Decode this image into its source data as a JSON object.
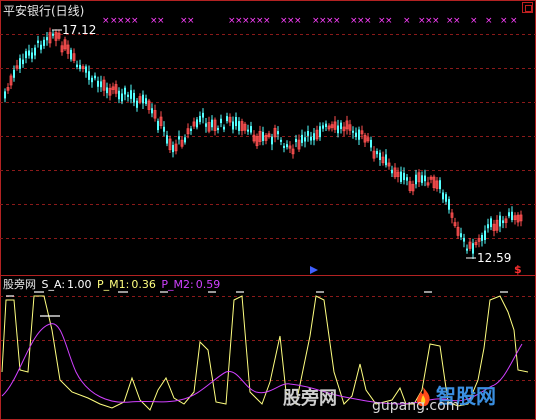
{
  "window": {
    "title": "平安银行(日线)"
  },
  "price_chart": {
    "high_label": "17.12",
    "low_label": "12.59",
    "cross_marker_glyph": "×",
    "colors": {
      "up": "#ff5050",
      "down": "#54ffff",
      "grid": "#8b1a1a",
      "frame": "#b22222",
      "cross": "#ff40ff"
    }
  },
  "indicator": {
    "name": "股旁网",
    "sa_label": "S_A:",
    "sa_value": "1.00",
    "pm1_label": "P_M1:",
    "pm1_value": "0.36",
    "pm2_label": "P_M2:",
    "pm2_value": "0.59",
    "colors": {
      "sa": "#ffffff",
      "pm1": "#ffff80",
      "pm2": "#d040ff"
    }
  },
  "watermark": {
    "text_cn": "股旁网",
    "logo_text": "智股网",
    "url": "gupang.com"
  },
  "icons": {
    "close": "close-box-icon",
    "arrow_up": "up-arrow-icon",
    "dollar": "dollar-sign-icon"
  }
}
